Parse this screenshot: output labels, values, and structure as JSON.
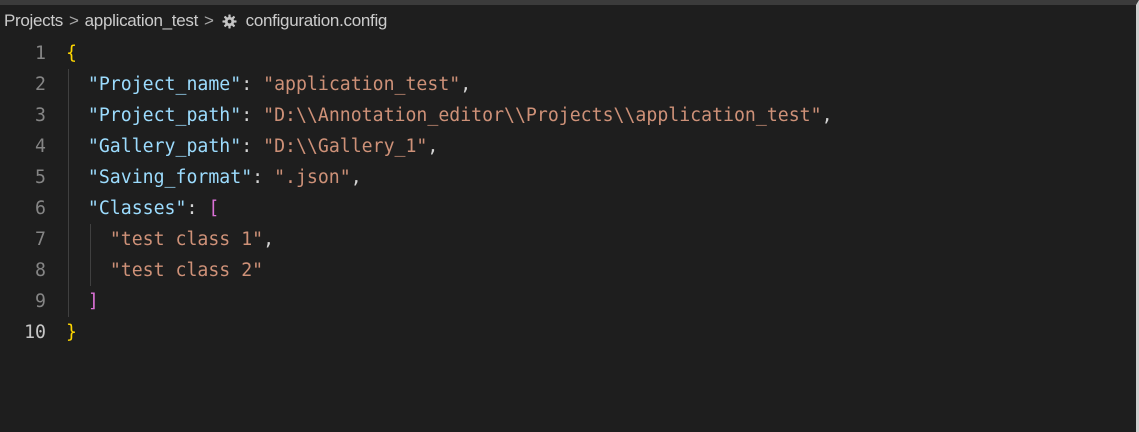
{
  "breadcrumb": {
    "items": [
      "Projects",
      "application_test",
      "configuration.config"
    ],
    "separator": ">",
    "file_icon": "gear-icon"
  },
  "editor": {
    "lines": [
      {
        "num": "1",
        "indent": "",
        "tokens": [
          {
            "t": "{",
            "c": "brace"
          }
        ]
      },
      {
        "num": "2",
        "indent": "  ",
        "tokens": [
          {
            "t": "\"Project_name\"",
            "c": "key"
          },
          {
            "t": ": ",
            "c": "punc"
          },
          {
            "t": "\"application_test\"",
            "c": "str"
          },
          {
            "t": ",",
            "c": "punc"
          }
        ]
      },
      {
        "num": "3",
        "indent": "  ",
        "tokens": [
          {
            "t": "\"Project_path\"",
            "c": "key"
          },
          {
            "t": ": ",
            "c": "punc"
          },
          {
            "t": "\"D:\\\\Annotation_editor\\\\Projects\\\\application_test\"",
            "c": "str"
          },
          {
            "t": ",",
            "c": "punc"
          }
        ]
      },
      {
        "num": "4",
        "indent": "  ",
        "tokens": [
          {
            "t": "\"Gallery_path\"",
            "c": "key"
          },
          {
            "t": ": ",
            "c": "punc"
          },
          {
            "t": "\"D:\\\\Gallery_1\"",
            "c": "str"
          },
          {
            "t": ",",
            "c": "punc"
          }
        ]
      },
      {
        "num": "5",
        "indent": "  ",
        "tokens": [
          {
            "t": "\"Saving_format\"",
            "c": "key"
          },
          {
            "t": ": ",
            "c": "punc"
          },
          {
            "t": "\".json\"",
            "c": "str"
          },
          {
            "t": ",",
            "c": "punc"
          }
        ]
      },
      {
        "num": "6",
        "indent": "  ",
        "tokens": [
          {
            "t": "\"Classes\"",
            "c": "key"
          },
          {
            "t": ": ",
            "c": "punc"
          },
          {
            "t": "[",
            "c": "bracket"
          }
        ]
      },
      {
        "num": "7",
        "indent": "    ",
        "tokens": [
          {
            "t": "\"test class 1\"",
            "c": "str"
          },
          {
            "t": ",",
            "c": "punc"
          }
        ]
      },
      {
        "num": "8",
        "indent": "    ",
        "tokens": [
          {
            "t": "\"test class 2\"",
            "c": "str"
          }
        ]
      },
      {
        "num": "9",
        "indent": "  ",
        "tokens": [
          {
            "t": "]",
            "c": "bracket"
          }
        ]
      },
      {
        "num": "10",
        "indent": "",
        "tokens": [
          {
            "t": "}",
            "c": "brace"
          }
        ]
      }
    ],
    "active_line": "10"
  },
  "colors": {
    "background": "#1e1e1e",
    "key": "#9cdcfe",
    "string": "#ce9178",
    "brace": "#ffd700",
    "bracket": "#da70d6",
    "line_number": "#858585"
  }
}
